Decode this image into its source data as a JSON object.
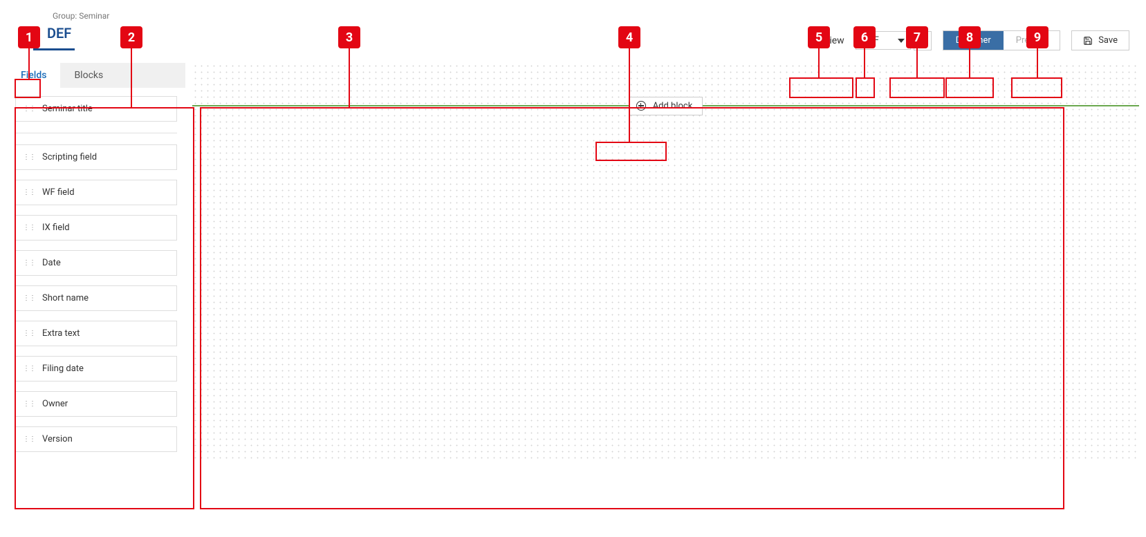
{
  "header": {
    "group_label": "Group: Seminar",
    "title": "DEF",
    "view_label": "View",
    "view_selected": "DEF",
    "designer_label": "Designer",
    "preview_label": "Preview",
    "save_label": "Save"
  },
  "sidebar": {
    "tabs": {
      "fields": "Fields",
      "blocks": "Blocks"
    },
    "fields": {
      "f0": "Seminar title",
      "f1": "Scripting field",
      "f2": "WF field",
      "f3": "IX field",
      "f4": "Date",
      "f5": "Short name",
      "f6": "Extra text",
      "f7": "Filing date",
      "f8": "Owner",
      "f9": "Version"
    }
  },
  "canvas": {
    "add_block_label": "Add block"
  },
  "annotations": {
    "a1": "1",
    "a2": "2",
    "a3": "3",
    "a4": "4",
    "a5": "5",
    "a6": "6",
    "a7": "7",
    "a8": "8",
    "a9": "9"
  }
}
